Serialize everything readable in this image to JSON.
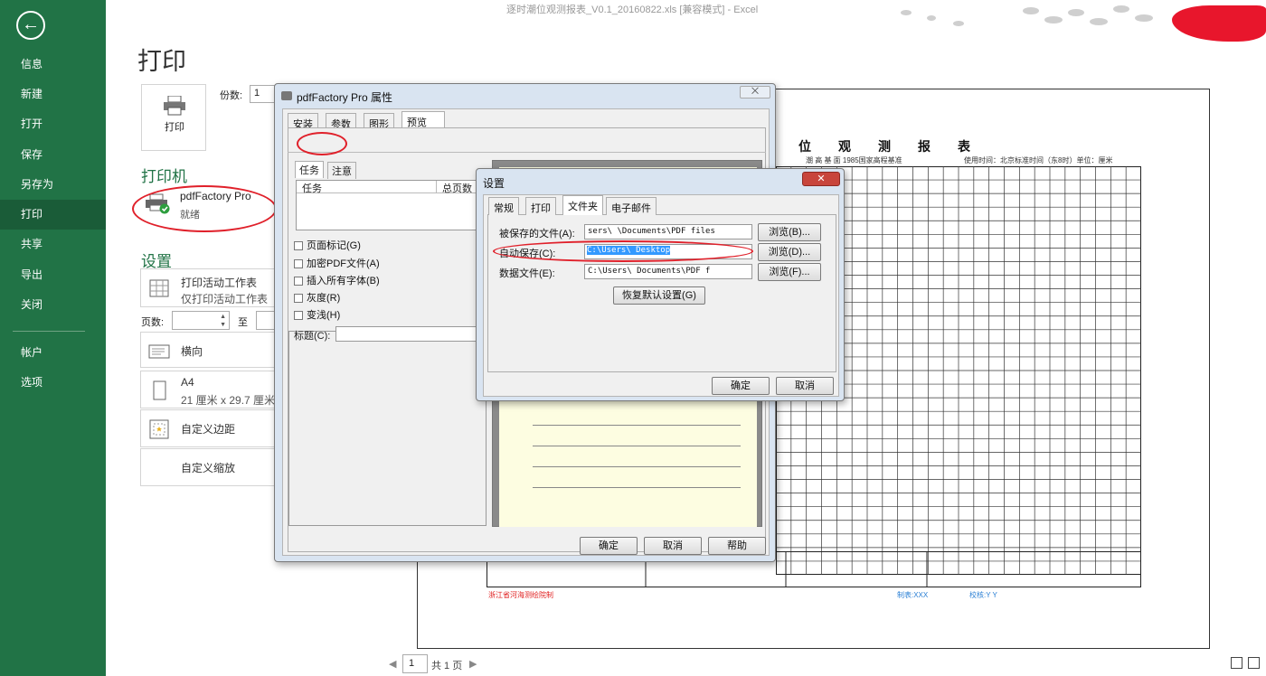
{
  "window": {
    "title": "逐时潮位观测报表_V0.1_20160822.xls  [兼容模式] - Excel"
  },
  "nav": {
    "back_icon": "←",
    "items": [
      {
        "label": "信息"
      },
      {
        "label": "新建"
      },
      {
        "label": "打开"
      },
      {
        "label": "保存"
      },
      {
        "label": "另存为"
      },
      {
        "label": "打印"
      },
      {
        "label": "共享"
      },
      {
        "label": "导出"
      },
      {
        "label": "关闭"
      },
      {
        "label": "帐户"
      },
      {
        "label": "选项"
      }
    ],
    "active": "打印",
    "bg_color": "#217346"
  },
  "backstage": {
    "title": "打印",
    "print_button": "打印",
    "copies_label": "份数:",
    "copies_value": "1",
    "printer_heading": "打印机",
    "printer_name": "pdfFactory Pro",
    "printer_status": "就绪",
    "settings_heading": "设置",
    "settings": {
      "scope_l1": "打印活动工作表",
      "scope_l2": "仅打印活动工作表",
      "pages_label": "页数:",
      "pages_to": "至",
      "orientation": "横向",
      "paper_l1": "A4",
      "paper_l2": "21 厘米 x 29.7 厘米",
      "margins": "自定义边距",
      "scaling": "自定义缩放"
    }
  },
  "preview": {
    "report_title": "位观测报表",
    "sub1": "潮 高 基 面   1985国家高程基准",
    "sub2": "使用时间：北京标准时间（东8时）单位：厘米",
    "footer_left": "浙江省河海测绘院制",
    "footer_mid": "制表:XXX",
    "footer_right": "校核:Y Y",
    "page_current": "1",
    "page_total": "共 1 页",
    "prev_icon": "◀",
    "next_icon": "▶"
  },
  "pdf_dialog": {
    "title": "pdfFactory Pro 属性",
    "close": "⨉",
    "tabs": [
      "安装",
      "参数",
      "图形",
      "预览"
    ],
    "selected_tab": "预览",
    "gear_icon": "⚙▾",
    "subtabs": [
      "任务",
      "注意"
    ],
    "task_columns": [
      "任务",
      "总页数"
    ],
    "checks": [
      "页面标记(G)",
      "加密PDF文件(A)",
      "插入所有字体(B)",
      "灰度(R)",
      "变浅(H)"
    ],
    "title_label": "标题(C):",
    "ok": "确定",
    "cancel": "取消",
    "help": "帮助"
  },
  "settings_dialog": {
    "title": "设置",
    "close": "✕",
    "tabs": [
      "常规",
      "打印",
      "文件夹",
      "电子邮件"
    ],
    "selected_tab": "文件夹",
    "rows": [
      {
        "label": "被保存的文件(A):",
        "value": "sers\\          \\Documents\\PDF files",
        "browse": "浏览(B)..."
      },
      {
        "label": "自动保存(C):",
        "value": "C:\\Users\\          Desktop",
        "browse": "浏览(D)..."
      },
      {
        "label": "数据文件(E):",
        "value": "C:\\Users\\          Documents\\PDF f",
        "browse": "浏览(F)..."
      }
    ],
    "restore": "恢复默认设置(G)",
    "ok": "确定",
    "cancel": "取消"
  }
}
